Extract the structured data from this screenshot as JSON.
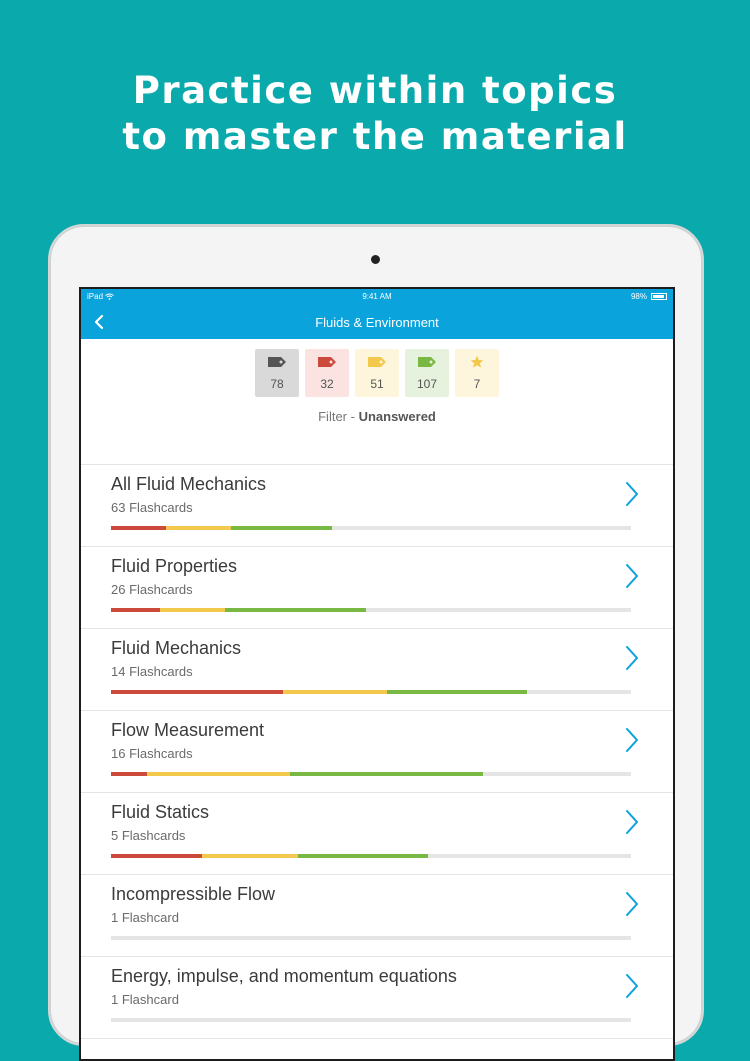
{
  "headline": {
    "line1": "Practice within topics",
    "line2": "to master the material"
  },
  "status_bar": {
    "carrier": "iPad",
    "time": "9:41 AM",
    "battery": "98%"
  },
  "nav": {
    "title": "Fluids & Environment"
  },
  "filters": [
    {
      "icon": "gray-tag-icon",
      "count": "78",
      "color": "#6b6b6b"
    },
    {
      "icon": "red-tag-icon",
      "count": "32",
      "color": "#cc4a3c"
    },
    {
      "icon": "yellow-tag-icon",
      "count": "51",
      "color": "#f2c94c"
    },
    {
      "icon": "green-tag-icon",
      "count": "107",
      "color": "#78b843"
    },
    {
      "icon": "star-icon",
      "count": "7",
      "color": "#f2c94c"
    }
  ],
  "filter_label": {
    "prefix": "Filter - ",
    "value": "Unanswered"
  },
  "colors": {
    "accent": "#0aa3dc",
    "background": "#0aa9ac",
    "red": "#cc4a3c",
    "yellow": "#f2c94c",
    "green": "#78b843",
    "track": "#e5e5e5"
  },
  "topics": [
    {
      "name": "All Fluid Mechanics",
      "count": "63 Flashcards",
      "progress": {
        "red": 0.105,
        "yellow": 0.125,
        "green": 0.195
      }
    },
    {
      "name": "Fluid Properties",
      "count": "26 Flashcards",
      "progress": {
        "red": 0.095,
        "yellow": 0.125,
        "green": 0.27
      }
    },
    {
      "name": "Fluid Mechanics",
      "count": "14 Flashcards",
      "progress": {
        "red": 0.33,
        "yellow": 0.2,
        "green": 0.27
      }
    },
    {
      "name": "Flow Measurement",
      "count": "16 Flashcards",
      "progress": {
        "red": 0.07,
        "yellow": 0.275,
        "green": 0.37
      }
    },
    {
      "name": "Fluid Statics",
      "count": "5 Flashcards",
      "progress": {
        "red": 0.175,
        "yellow": 0.185,
        "green": 0.25
      }
    },
    {
      "name": "Incompressible Flow",
      "count": "1 Flashcard",
      "progress": {
        "red": 0,
        "yellow": 0,
        "green": 0
      }
    },
    {
      "name": "Energy, impulse, and momentum equations",
      "count": "1 Flashcard",
      "progress": {
        "red": 0,
        "yellow": 0,
        "green": 0
      }
    }
  ]
}
